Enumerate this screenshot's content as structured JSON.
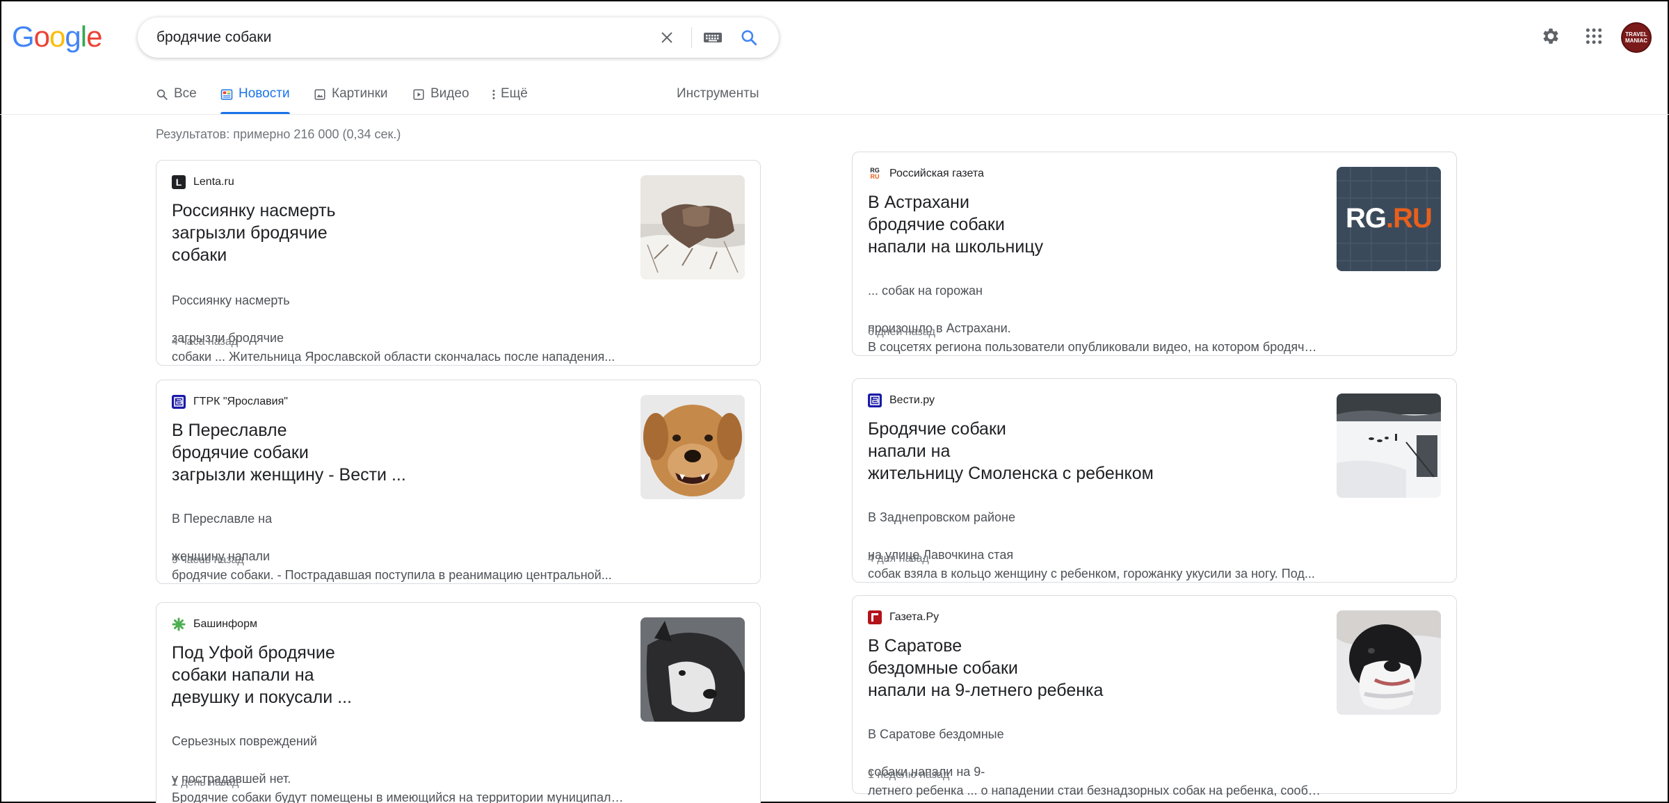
{
  "logo": {
    "letters": [
      "G",
      "o",
      "o",
      "g",
      "l",
      "e"
    ],
    "colors": [
      "#4285f4",
      "#ea4335",
      "#fbbc05",
      "#4285f4",
      "#34a853",
      "#ea4335"
    ]
  },
  "search": {
    "query": "бродячие собаки",
    "clear_icon": "close-icon",
    "keyboard_icon": "keyboard-icon",
    "search_icon": "search-icon"
  },
  "header_right": {
    "settings_icon": "gear-icon",
    "apps_icon": "apps-grid-icon",
    "avatar_line1": "TRAVEL",
    "avatar_line2": "MANIAC"
  },
  "tabs": [
    {
      "label": "Все",
      "icon": "search-icon",
      "active": false
    },
    {
      "label": "Новости",
      "icon": "news-icon",
      "active": true
    },
    {
      "label": "Картинки",
      "icon": "image-icon",
      "active": false
    },
    {
      "label": "Видео",
      "icon": "video-icon",
      "active": false
    },
    {
      "label": "Ещё",
      "icon": "more-vert-icon",
      "active": false
    }
  ],
  "tools_label": "Инструменты",
  "results_stats": "Результатов: примерно 216 000 (0,34 сек.)",
  "accent_color": "#1a73e8",
  "cards": [
    {
      "source": "Lenta.ru",
      "favicon": {
        "char": "L",
        "bg": "#202124"
      },
      "title": "Россиянку насмерть\nзагрызли бродячие\nсобаки",
      "snippet_lines": [
        "Россиянку насмерть",
        "загрызли бродячие",
        "собаки ... Жительница Ярославской области скончалась после нападения..."
      ],
      "time": "4 часа назад",
      "thumb": "wolf-in-snow-image"
    },
    {
      "source": "ГТРК \"Ярославия\"",
      "favicon": {
        "char": "В",
        "bg": "#1a1aa8"
      },
      "title": "В Переславле\nбродячие собаки\nзагрызли женщину - Вести ...",
      "snippet_lines": [
        "В Переславле на",
        "женщину напали",
        "бродячие собаки. - Пострадавшая поступила в реанимацию центральной..."
      ],
      "time": "9 часов назад",
      "thumb": "angry-dog-image"
    },
    {
      "source": "Башинформ",
      "favicon": {
        "char": "✱",
        "bg": "#ffffff"
      },
      "title": "Под Уфой бродячие\nсобаки напали на\nдевушку и покусали ...",
      "snippet_lines": [
        "Серьезных повреждений",
        "у пострадавшей нет.",
        "Бродячие собаки будут помещены в имеющийся на территории муниципалитета..."
      ],
      "time": "1 день назад",
      "thumb": "husky-dog-image"
    },
    {
      "source": "Российская газета",
      "favicon": {
        "char": "RG",
        "bg": "#ffffff"
      },
      "title": "В Астрахани\nбродячие собаки\nнапали на школьницу",
      "snippet_lines": [
        "... собак на горожан",
        "произошло в Астрахани.",
        "В соцсетях региона пользователи опубликовали видео, на котором бродячие..."
      ],
      "time": "6 дней назад",
      "thumb": "rg-ru-logo-image",
      "thumb_text_a": "RG",
      "thumb_text_b": ".RU"
    },
    {
      "source": "Вести.ру",
      "favicon": {
        "char": "В",
        "bg": "#1a1aa8"
      },
      "title": "Бродячие собаки\nнапали на\nжительницу Смоленска с ребенком",
      "snippet_lines": [
        "В Заднепровском районе",
        "на улице Лавочкина стая",
        "собак взяла в кольцо женщину с ребенком, горожанку укусили за ногу. Под..."
      ],
      "time": "4 дня назад",
      "thumb": "snowy-yard-image"
    },
    {
      "source": "Газета.Ру",
      "favicon": {
        "char": "Г",
        "bg": "#b3131b"
      },
      "title": "В Саратове\nбездомные собаки\nнапали на 9-летнего ребенка",
      "snippet_lines": [
        "В Саратове бездомные",
        "собаки напали на 9-",
        "летнего ребенка ... о нападении стаи безнадзорных собак на ребенка, сообщает..."
      ],
      "time": "1 неделю назад",
      "thumb": "black-white-dog-image"
    }
  ]
}
